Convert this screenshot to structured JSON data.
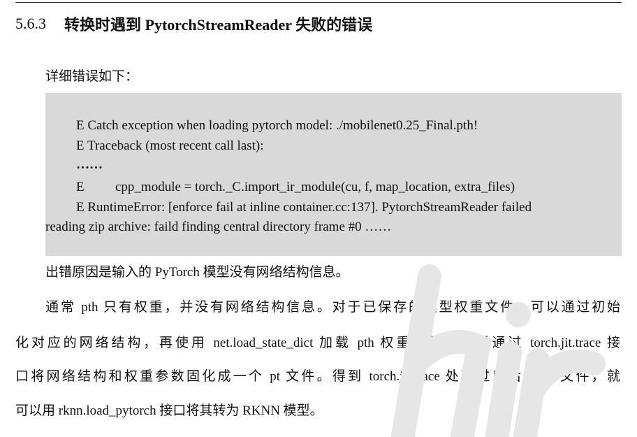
{
  "section": {
    "number": "5.6.3",
    "title": "转换时遇到 PytorchStreamReader 失败的错误"
  },
  "intro": "详细错误如下：",
  "code": {
    "line1": "E Catch exception when loading pytorch model: ./mobilenet0.25_Final.pth!",
    "line2": "E Traceback (most recent call last):",
    "line3": "……",
    "line4_prefix": "E",
    "line4_code": "cpp_module = torch._C.import_ir_module(cu, f, map_location, extra_files)",
    "line5": "E RuntimeError: [enforce fail at inline container.cc:137]. PytorchStreamReader failed",
    "line6": "reading zip archive: faild finding central directory frame #0 ……"
  },
  "cause": "出错原因是输入的 PyTorch 模型没有网络结构信息。",
  "solution": {
    "line1": "通常 pth 只有权重，并没有网络结构信息。对于已保存的模型权重文件，可以通过初始",
    "line2": "化对应的网络结构，再使用 net.load_state_dict 加载 pth 权重文件。最后通过 torch.jit.trace 接",
    "line3": "口将网络结构和权重参数固化成一个 pt 文件。得到 torch.jit.trace 处理过以后的 pt 文件，就",
    "line4": "可以用 rknn.load_pytorch 接口将其转为 RKNN 模型。"
  },
  "colors": {
    "code_background": "#d9d9d9",
    "text": "#111111",
    "watermark": "#e6e6e6"
  }
}
